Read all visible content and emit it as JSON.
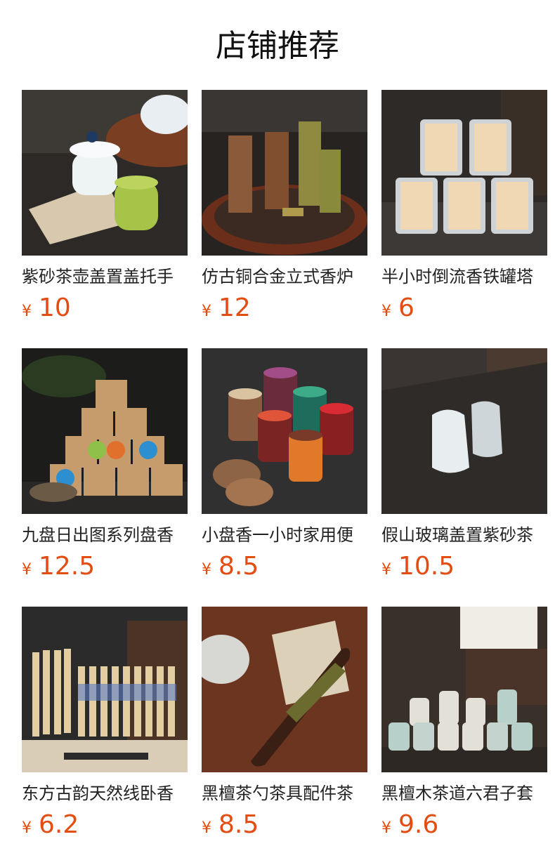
{
  "header": {
    "title": "店铺推荐"
  },
  "currency_symbol": "¥",
  "accent_color": "#e34d12",
  "products": [
    {
      "name": "紫砂茶壶盖置盖托手",
      "price": "10",
      "image": "tea-lid-holder-photo"
    },
    {
      "name": "仿古铜合金立式香炉",
      "price": "12",
      "image": "incense-burner-photo"
    },
    {
      "name": "半小时倒流香铁罐塔",
      "price": "6",
      "image": "incense-tins-photo"
    },
    {
      "name": "九盘日出图系列盘香",
      "price": "12.5",
      "image": "coil-incense-boxes-photo"
    },
    {
      "name": "小盘香一小时家用便",
      "price": "8.5",
      "image": "small-coil-incense-photo"
    },
    {
      "name": "假山玻璃盖置紫砂茶",
      "price": "10.5",
      "image": "glass-lid-rest-photo"
    },
    {
      "name": "东方古韵天然线卧香",
      "price": "6.2",
      "image": "stick-incense-tubes-photo"
    },
    {
      "name": "黑檀茶勺茶具配件茶",
      "price": "8.5",
      "image": "ebony-tea-scoop-photo"
    },
    {
      "name": "黑檀木茶道六君子套",
      "price": "9.6",
      "image": "tea-ceremony-set-photo"
    }
  ]
}
